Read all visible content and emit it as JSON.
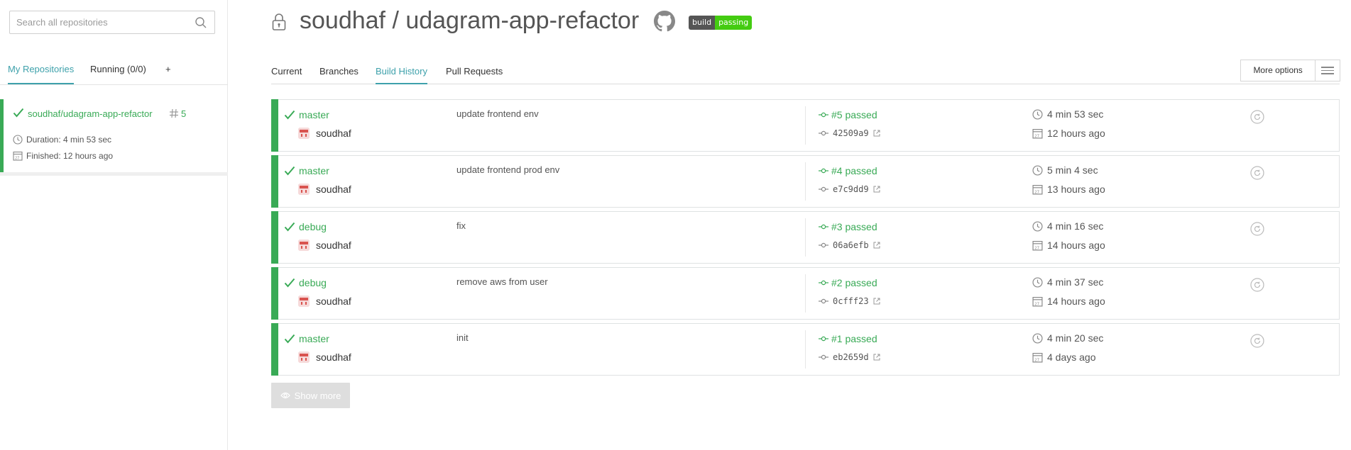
{
  "sidebar": {
    "search_placeholder": "Search all repositories",
    "tabs": [
      "My Repositories",
      "Running (0/0)",
      "+"
    ],
    "repo": {
      "name": "soudhaf/udagram-app-refactor",
      "build_number": "5",
      "duration": "Duration: 4 min 53 sec",
      "finished": "Finished: 12 hours ago"
    }
  },
  "header": {
    "title": "soudhaf / udagram-app-refactor",
    "badge_left": "build",
    "badge_right": "passing"
  },
  "tabs": [
    "Current",
    "Branches",
    "Build History",
    "Pull Requests"
  ],
  "more_options": "More options",
  "builds": [
    {
      "branch": "master",
      "author": "soudhaf",
      "message": "update frontend env",
      "number": "#5 passed",
      "sha": "42509a9",
      "duration": "4 min 53 sec",
      "finished": "12 hours ago"
    },
    {
      "branch": "master",
      "author": "soudhaf",
      "message": "update frontend prod env",
      "number": "#4 passed",
      "sha": "e7c9dd9",
      "duration": "5 min 4 sec",
      "finished": "13 hours ago"
    },
    {
      "branch": "debug",
      "author": "soudhaf",
      "message": "fix",
      "number": "#3 passed",
      "sha": "06a6efb",
      "duration": "4 min 16 sec",
      "finished": "14 hours ago"
    },
    {
      "branch": "debug",
      "author": "soudhaf",
      "message": "remove aws from user",
      "number": "#2 passed",
      "sha": "0cfff23",
      "duration": "4 min 37 sec",
      "finished": "14 hours ago"
    },
    {
      "branch": "master",
      "author": "soudhaf",
      "message": "init",
      "number": "#1 passed",
      "sha": "eb2659d",
      "duration": "4 min 20 sec",
      "finished": "4 days ago"
    }
  ],
  "show_more": "Show more",
  "colors": {
    "passed": "#39aa56",
    "accent": "#3ea1ab"
  }
}
